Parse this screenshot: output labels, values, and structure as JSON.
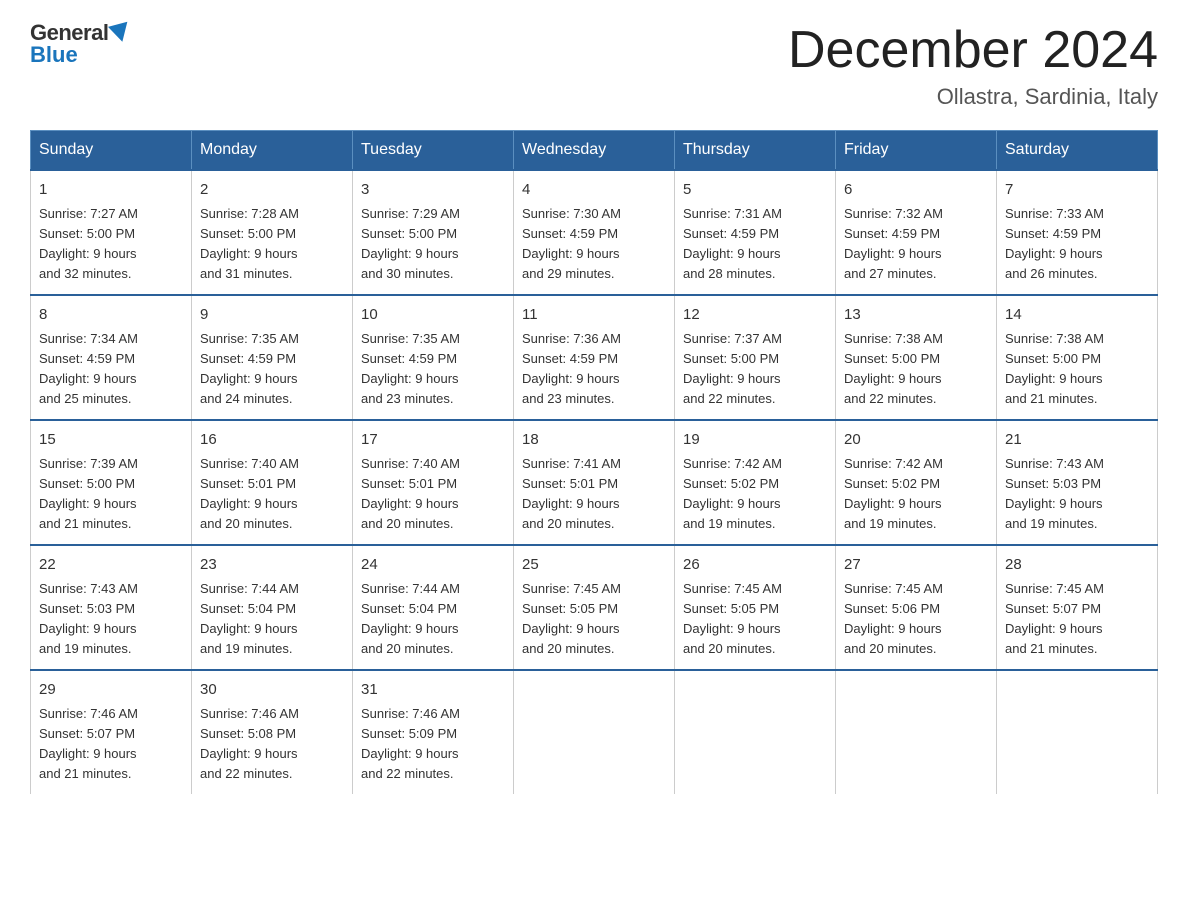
{
  "header": {
    "logo_general": "General",
    "logo_blue": "Blue",
    "month_title": "December 2024",
    "location": "Ollastra, Sardinia, Italy"
  },
  "days_of_week": [
    "Sunday",
    "Monday",
    "Tuesday",
    "Wednesday",
    "Thursday",
    "Friday",
    "Saturday"
  ],
  "weeks": [
    [
      {
        "num": "1",
        "sunrise": "7:27 AM",
        "sunset": "5:00 PM",
        "daylight": "9 hours and 32 minutes."
      },
      {
        "num": "2",
        "sunrise": "7:28 AM",
        "sunset": "5:00 PM",
        "daylight": "9 hours and 31 minutes."
      },
      {
        "num": "3",
        "sunrise": "7:29 AM",
        "sunset": "5:00 PM",
        "daylight": "9 hours and 30 minutes."
      },
      {
        "num": "4",
        "sunrise": "7:30 AM",
        "sunset": "4:59 PM",
        "daylight": "9 hours and 29 minutes."
      },
      {
        "num": "5",
        "sunrise": "7:31 AM",
        "sunset": "4:59 PM",
        "daylight": "9 hours and 28 minutes."
      },
      {
        "num": "6",
        "sunrise": "7:32 AM",
        "sunset": "4:59 PM",
        "daylight": "9 hours and 27 minutes."
      },
      {
        "num": "7",
        "sunrise": "7:33 AM",
        "sunset": "4:59 PM",
        "daylight": "9 hours and 26 minutes."
      }
    ],
    [
      {
        "num": "8",
        "sunrise": "7:34 AM",
        "sunset": "4:59 PM",
        "daylight": "9 hours and 25 minutes."
      },
      {
        "num": "9",
        "sunrise": "7:35 AM",
        "sunset": "4:59 PM",
        "daylight": "9 hours and 24 minutes."
      },
      {
        "num": "10",
        "sunrise": "7:35 AM",
        "sunset": "4:59 PM",
        "daylight": "9 hours and 23 minutes."
      },
      {
        "num": "11",
        "sunrise": "7:36 AM",
        "sunset": "4:59 PM",
        "daylight": "9 hours and 23 minutes."
      },
      {
        "num": "12",
        "sunrise": "7:37 AM",
        "sunset": "5:00 PM",
        "daylight": "9 hours and 22 minutes."
      },
      {
        "num": "13",
        "sunrise": "7:38 AM",
        "sunset": "5:00 PM",
        "daylight": "9 hours and 22 minutes."
      },
      {
        "num": "14",
        "sunrise": "7:38 AM",
        "sunset": "5:00 PM",
        "daylight": "9 hours and 21 minutes."
      }
    ],
    [
      {
        "num": "15",
        "sunrise": "7:39 AM",
        "sunset": "5:00 PM",
        "daylight": "9 hours and 21 minutes."
      },
      {
        "num": "16",
        "sunrise": "7:40 AM",
        "sunset": "5:01 PM",
        "daylight": "9 hours and 20 minutes."
      },
      {
        "num": "17",
        "sunrise": "7:40 AM",
        "sunset": "5:01 PM",
        "daylight": "9 hours and 20 minutes."
      },
      {
        "num": "18",
        "sunrise": "7:41 AM",
        "sunset": "5:01 PM",
        "daylight": "9 hours and 20 minutes."
      },
      {
        "num": "19",
        "sunrise": "7:42 AM",
        "sunset": "5:02 PM",
        "daylight": "9 hours and 19 minutes."
      },
      {
        "num": "20",
        "sunrise": "7:42 AM",
        "sunset": "5:02 PM",
        "daylight": "9 hours and 19 minutes."
      },
      {
        "num": "21",
        "sunrise": "7:43 AM",
        "sunset": "5:03 PM",
        "daylight": "9 hours and 19 minutes."
      }
    ],
    [
      {
        "num": "22",
        "sunrise": "7:43 AM",
        "sunset": "5:03 PM",
        "daylight": "9 hours and 19 minutes."
      },
      {
        "num": "23",
        "sunrise": "7:44 AM",
        "sunset": "5:04 PM",
        "daylight": "9 hours and 19 minutes."
      },
      {
        "num": "24",
        "sunrise": "7:44 AM",
        "sunset": "5:04 PM",
        "daylight": "9 hours and 20 minutes."
      },
      {
        "num": "25",
        "sunrise": "7:45 AM",
        "sunset": "5:05 PM",
        "daylight": "9 hours and 20 minutes."
      },
      {
        "num": "26",
        "sunrise": "7:45 AM",
        "sunset": "5:05 PM",
        "daylight": "9 hours and 20 minutes."
      },
      {
        "num": "27",
        "sunrise": "7:45 AM",
        "sunset": "5:06 PM",
        "daylight": "9 hours and 20 minutes."
      },
      {
        "num": "28",
        "sunrise": "7:45 AM",
        "sunset": "5:07 PM",
        "daylight": "9 hours and 21 minutes."
      }
    ],
    [
      {
        "num": "29",
        "sunrise": "7:46 AM",
        "sunset": "5:07 PM",
        "daylight": "9 hours and 21 minutes."
      },
      {
        "num": "30",
        "sunrise": "7:46 AM",
        "sunset": "5:08 PM",
        "daylight": "9 hours and 22 minutes."
      },
      {
        "num": "31",
        "sunrise": "7:46 AM",
        "sunset": "5:09 PM",
        "daylight": "9 hours and 22 minutes."
      },
      null,
      null,
      null,
      null
    ]
  ]
}
